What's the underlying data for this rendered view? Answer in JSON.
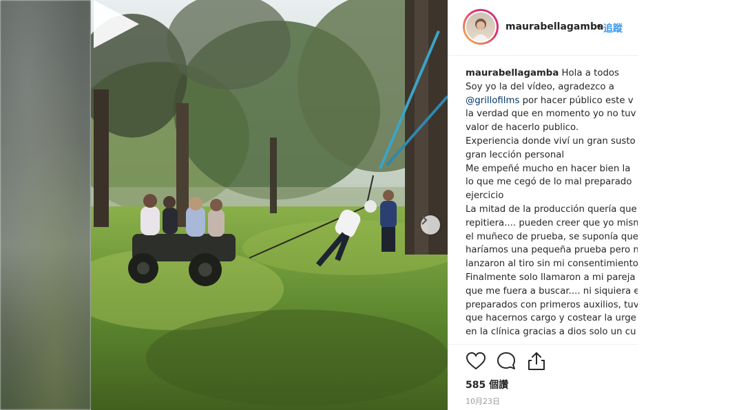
{
  "post": {
    "username": "maurabellagamba",
    "separator": "•",
    "follow_label": "追蹤",
    "caption_user": "maurabellagamba",
    "caption_first": "Hola a todos",
    "caption_lines": [
      "Soy yo la del vídeo, agradezco a",
      "por hacer público este v",
      "la verdad que en momento yo no tuv",
      "valor de hacerlo publico.",
      "Experiencia donde viví un gran susto",
      "gran lección personal",
      "Me empeñé mucho en hacer bien la",
      "lo que me cegó de lo mal preparado",
      "ejercicio",
      "La mitad de la producción quería que",
      "repitiera.... pueden creer que yo mism",
      "el muñeco de prueba, se suponía que",
      "haríamos una pequeña prueba pero n",
      "lanzaron al tiro sin mi consentimiento",
      "Finalmente solo llamaron a mi pareja",
      "que me fuera a buscar.... ni siquiera e",
      "preparados con primeros auxilios, tuv",
      "que hacernos cargo y costear la urge",
      "en la clínica gracias a dios solo un cu"
    ],
    "mention": "@grillofilms",
    "likes": "585 個讚",
    "date": "10月23日"
  },
  "icons": {
    "play": "play-icon",
    "next": "chevron-right-icon",
    "like": "heart-icon",
    "comment": "comment-icon",
    "share": "share-icon"
  },
  "colors": {
    "link": "#3897f0",
    "text": "#262626",
    "muted": "#999999"
  }
}
